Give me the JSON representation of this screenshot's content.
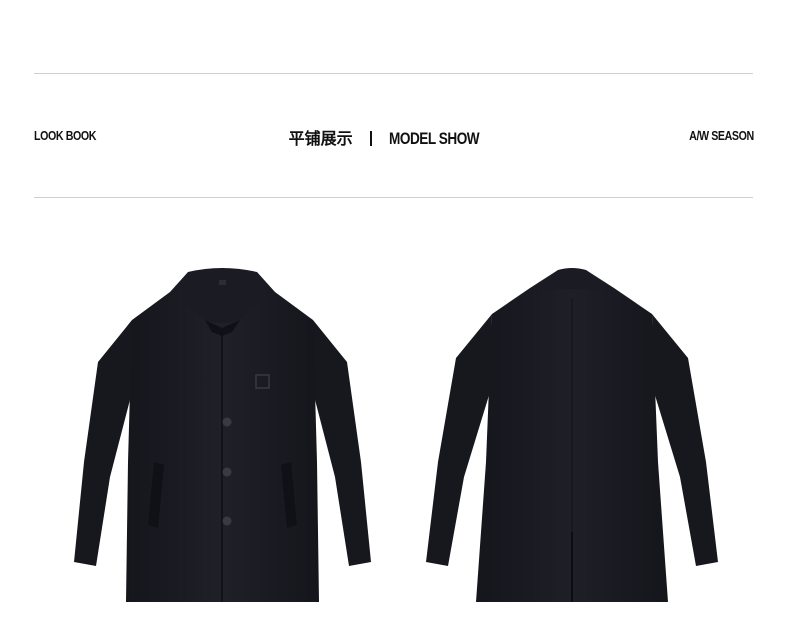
{
  "header": {
    "left_label": "LOOK BOOK",
    "title_cn": "平铺展示",
    "title_en": "MODEL SHOW",
    "right_label": "A/W SEASON"
  },
  "images": [
    {
      "name": "coat-front-view",
      "icon": "coat-front-photo"
    },
    {
      "name": "coat-back-view",
      "icon": "coat-back-photo"
    }
  ],
  "colors": {
    "coat": "#1c1d24",
    "rule": "#cfcfcf",
    "text": "#111111"
  }
}
